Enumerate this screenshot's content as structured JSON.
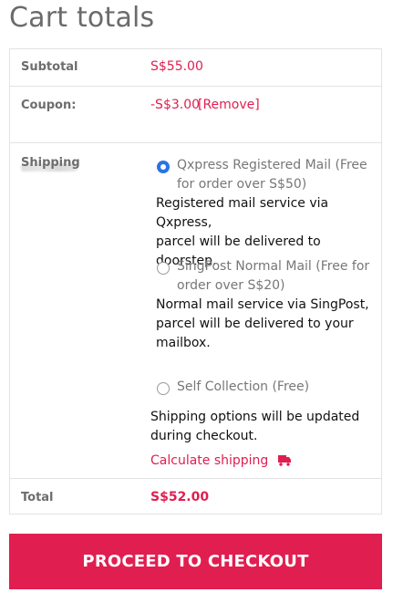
{
  "title": "Cart totals",
  "subtotal": {
    "label": "Subtotal",
    "value": "S$55.00"
  },
  "coupon": {
    "label": "Coupon:",
    "value": "-S$3.00",
    "remove": "[Remove]"
  },
  "shipping": {
    "label": "Shipping",
    "options": [
      {
        "label_line1": "Qxpress Registered Mail (Free",
        "label_line2": "for order over S$50)",
        "desc_line1": "Registered mail service via Qxpress,",
        "desc_line2": "parcel will be delivered to doorstep.",
        "desc_line3": "",
        "checked": true
      },
      {
        "label_line1": "SingPost Normal Mail (Free for",
        "label_line2": "order over S$20)",
        "desc_line1": "Normal mail service via SingPost,",
        "desc_line2": "parcel will be delivered to your",
        "desc_line3": "mailbox.",
        "checked": false
      },
      {
        "label_line1": "Self Collection (Free)",
        "label_line2": "",
        "desc_line1": "",
        "desc_line2": "",
        "desc_line3": "",
        "checked": false
      }
    ],
    "note_line1": "Shipping options will be updated",
    "note_line2": "during checkout.",
    "calculate": "Calculate shipping",
    "calculate_icon": "truck-icon"
  },
  "total": {
    "label": "Total",
    "value": "S$52.00"
  },
  "checkout_button": "PROCEED TO CHECKOUT",
  "accent_color": "#e01e50",
  "radio_color": "#2a73e8"
}
